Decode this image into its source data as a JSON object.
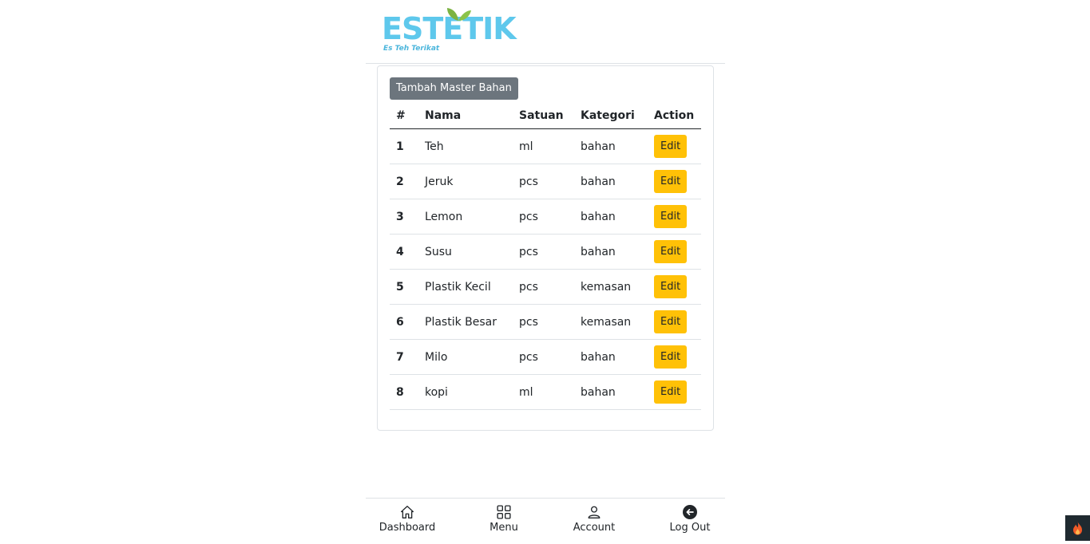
{
  "brand": {
    "name": "ESTETIK",
    "tagline": "Es Teh Terikat"
  },
  "actions": {
    "add_label": "Tambah Master Bahan"
  },
  "table": {
    "headers": [
      "#",
      "Nama",
      "Satuan",
      "Kategori",
      "Action"
    ],
    "rows": [
      {
        "no": "1",
        "nama": "Teh",
        "satuan": "ml",
        "kategori": "bahan",
        "action": "Edit"
      },
      {
        "no": "2",
        "nama": "Jeruk",
        "satuan": "pcs",
        "kategori": "bahan",
        "action": "Edit"
      },
      {
        "no": "3",
        "nama": "Lemon",
        "satuan": "pcs",
        "kategori": "bahan",
        "action": "Edit"
      },
      {
        "no": "4",
        "nama": "Susu",
        "satuan": "pcs",
        "kategori": "bahan",
        "action": "Edit"
      },
      {
        "no": "5",
        "nama": "Plastik Kecil",
        "satuan": "pcs",
        "kategori": "kemasan",
        "action": "Edit"
      },
      {
        "no": "6",
        "nama": "Plastik Besar",
        "satuan": "pcs",
        "kategori": "kemasan",
        "action": "Edit"
      },
      {
        "no": "7",
        "nama": "Milo",
        "satuan": "pcs",
        "kategori": "bahan",
        "action": "Edit"
      },
      {
        "no": "8",
        "nama": "kopi",
        "satuan": "ml",
        "kategori": "bahan",
        "action": "Edit"
      }
    ]
  },
  "nav": {
    "items": [
      {
        "label": "Dashboard",
        "icon": "home-icon"
      },
      {
        "label": "Menu",
        "icon": "grid-icon"
      },
      {
        "label": "Account",
        "icon": "person-icon"
      },
      {
        "label": "Log Out",
        "icon": "arrow-left-circle-icon"
      }
    ]
  },
  "colors": {
    "accent": "#5ec8ec",
    "edit": "#ffc107",
    "secondary": "#6c757d"
  }
}
